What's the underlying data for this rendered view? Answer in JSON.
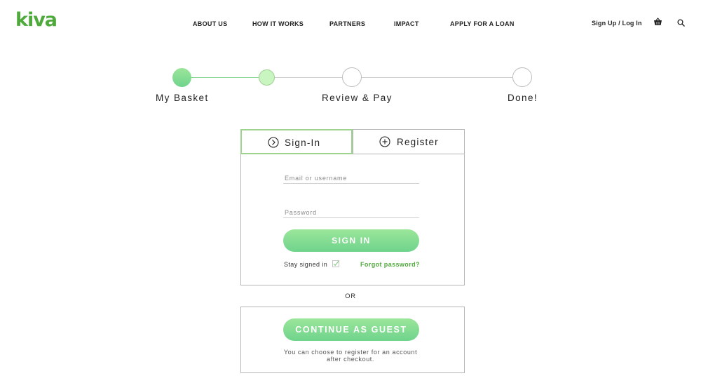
{
  "header": {
    "logo": "kiva",
    "nav": [
      "ABOUT US",
      "HOW IT WORKS",
      "PARTNERS",
      "IMPACT",
      "APPLY FOR A LOAN"
    ],
    "signup_login": "Sign Up / Log In",
    "icons": [
      "basket-icon",
      "search-icon"
    ]
  },
  "progress": {
    "steps": [
      "My Basket",
      "Review & Pay",
      "Done!"
    ],
    "current_step": 1
  },
  "auth": {
    "tabs": [
      "Sign-In",
      "Register"
    ],
    "active_tab": "Sign-In",
    "email_placeholder": "Email or username",
    "password_placeholder": "Password",
    "email_value": "",
    "password_value": "",
    "signin_button": "SIGN IN",
    "stay_signed_in": "Stay signed in",
    "stay_signed_in_checked": true,
    "forgot_password": "Forgot password?"
  },
  "or_text": "OR",
  "guest": {
    "button": "CONTINUE AS GUEST",
    "note_line1": "You can choose to register for an account",
    "note_line2": "after checkout."
  },
  "colors": {
    "brand_green": "#4faa3c",
    "button_green": "#7fdc8f",
    "active_tab_border": "#9ed38f"
  }
}
